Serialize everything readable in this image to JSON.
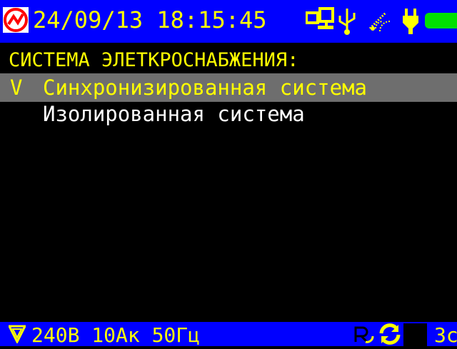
{
  "status_bar": {
    "datetime": "24/09/13 18:15:45",
    "icons": [
      "logo-icon",
      "network-icon",
      "usb-icon",
      "wireless-icon",
      "power-plug-icon",
      "battery-icon"
    ],
    "colors": {
      "background": "#0000ff",
      "text": "#ffff00",
      "logo": "#ff0000",
      "battery": "#00e000"
    }
  },
  "menu": {
    "title": "СИСТЕМА ЭЛЕТКРОСНАБЖЕНИЯ:",
    "selected_mark": "V",
    "items": [
      {
        "label": "Синхронизированная система",
        "selected": true
      },
      {
        "label": "Изолированная система",
        "selected": false
      }
    ],
    "colors": {
      "selection": "#6e6e6e",
      "item_text": "#ffffff",
      "title_text": "#ffff00"
    }
  },
  "bottom_bar": {
    "settings": "240В 10Ак 50Гц",
    "right_text": "3с",
    "icons": [
      "filter-icon",
      "rotation-icon",
      "sync-icon"
    ]
  }
}
